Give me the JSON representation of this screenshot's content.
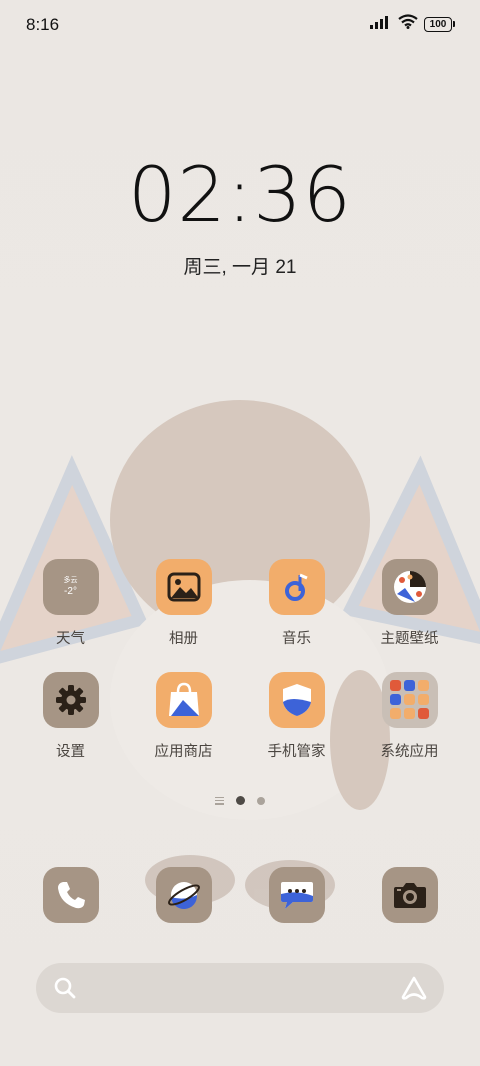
{
  "status_bar": {
    "time": "8:16",
    "battery": "100",
    "icons": [
      "signal-icon",
      "wifi-icon",
      "battery-icon"
    ]
  },
  "lock_clock": {
    "time": "02:36",
    "date": "周三, 一月 21"
  },
  "weather_widget": {
    "condition": "多云",
    "temperature": "-2°"
  },
  "apps": [
    {
      "label": "天气",
      "icon": "weather-icon"
    },
    {
      "label": "相册",
      "icon": "gallery-icon"
    },
    {
      "label": "音乐",
      "icon": "music-icon"
    },
    {
      "label": "主题壁纸",
      "icon": "theme-palette-icon"
    },
    {
      "label": "设置",
      "icon": "settings-gear-icon"
    },
    {
      "label": "应用商店",
      "icon": "app-store-bag-icon"
    },
    {
      "label": "手机管家",
      "icon": "phone-manager-shield-icon"
    },
    {
      "label": "系统应用",
      "icon": "folder-icon"
    }
  ],
  "pager": {
    "pages": 2,
    "active": 1
  },
  "dock": [
    {
      "icon": "phone-icon"
    },
    {
      "icon": "browser-icon"
    },
    {
      "icon": "messages-icon"
    },
    {
      "icon": "camera-icon"
    }
  ],
  "colors": {
    "background": "#ebe7e3",
    "tile_brown": "#a69585",
    "tile_orange": "#f2ad6b",
    "accent_blue": "#3d63d8"
  }
}
